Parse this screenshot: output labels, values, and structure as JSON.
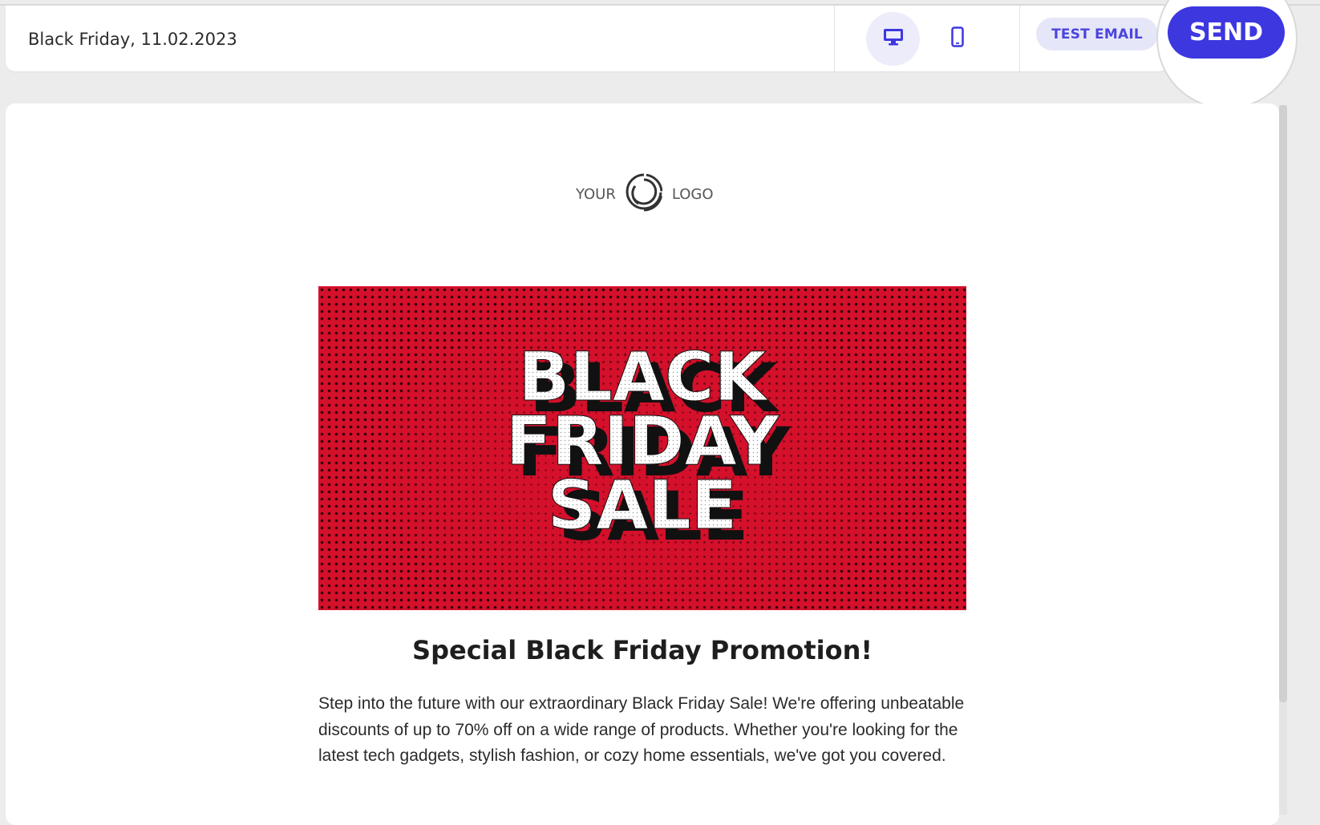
{
  "header": {
    "subject": "Black Friday, 11.02.2023",
    "desktop_icon": "desktop-icon",
    "mobile_icon": "mobile-icon",
    "test_email_label": "TEST EMAIL",
    "send_label": "SEND"
  },
  "email": {
    "logo_left": "YOUR",
    "logo_right": "LOGO",
    "banner_lines": [
      "BLACK",
      "FRIDAY",
      "SALE"
    ],
    "headline": "Special Black Friday Promotion!",
    "body": "Step into the future with our extraordinary Black Friday Sale! We're offering unbeatable discounts of up to 70% off on a wide range of products. Whether you're looking for the latest tech gadgets, stylish fashion, or cozy home essentials, we've got you covered."
  },
  "colors": {
    "accent": "#3d37e0",
    "accent_light": "#e6e6f9",
    "banner_red": "#d4102b"
  }
}
